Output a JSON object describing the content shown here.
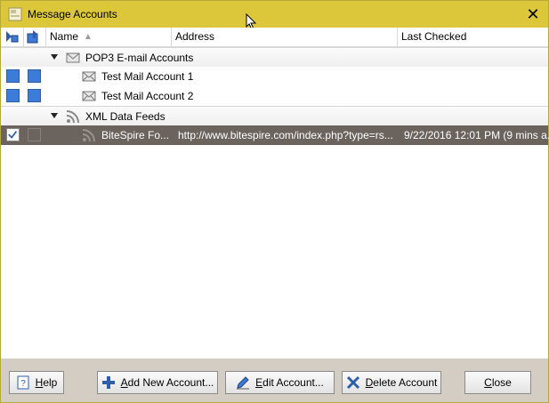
{
  "window": {
    "title": "Message Accounts"
  },
  "columns": {
    "name": "Name",
    "address": "Address",
    "last_checked": "Last Checked"
  },
  "groups": [
    {
      "label": "POP3 E-mail Accounts",
      "items": [
        {
          "name": "Test Mail Account 1",
          "address": "",
          "last_checked": ""
        },
        {
          "name": "Test Mail Account 2",
          "address": "",
          "last_checked": ""
        }
      ]
    },
    {
      "label": "XML Data Feeds",
      "items": [
        {
          "name": "BiteSpire Fo...",
          "address": "http://www.bitespire.com/index.php?type=rs...",
          "last_checked": "9/22/2016 12:01 PM (9 mins a..."
        }
      ]
    }
  ],
  "buttons": {
    "help": "Help",
    "add": "Add New Account...",
    "edit": "Edit Account...",
    "delete": "Delete Account",
    "close": "Close"
  },
  "colors": {
    "titlebar": "#dcc73a",
    "selection": "#6b635e",
    "checkbox_blue": "#3d7bd9",
    "footer": "#d4cdc4"
  }
}
